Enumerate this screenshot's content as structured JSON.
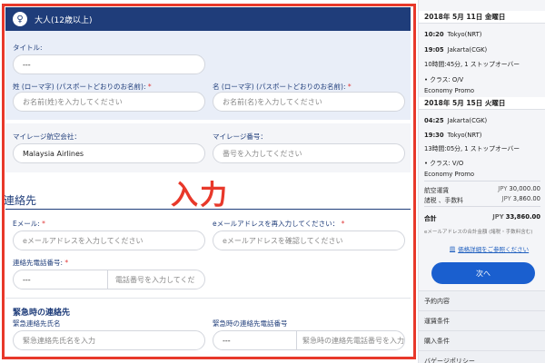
{
  "passenger": {
    "icon": "person-icon",
    "title": "大人(12歳以上)"
  },
  "form": {
    "title_label": "タイトル:",
    "title_value": "---",
    "last_name_label": "姓 (ローマ字) (パスポートどおりのお名前):",
    "last_name_placeholder": "お名前(姓)を入力してください",
    "first_name_label": "名 (ローマ字) (パスポートどおりのお名前):",
    "first_name_placeholder": "お名前(名)を入力してください",
    "required_mark": "*",
    "mileage_airline_label": "マイレージ航空会社：",
    "mileage_airline_value": "Malaysia Airlines",
    "mileage_number_label": "マイレージ番号：",
    "mileage_number_placeholder": "番号を入力してください"
  },
  "contact": {
    "heading": "連絡先",
    "email_label": "Eメール:",
    "email_placeholder": "eメールアドレスを入力してください",
    "email_confirm_label": "eメールアドレスを再入力してください：",
    "email_confirm_placeholder": "eメールアドレスを確認してください",
    "phone_label": "連絡先電話番号:",
    "phone_code": "---",
    "phone_placeholder": "電話番号を入力してくだ"
  },
  "emergency": {
    "heading": "緊急時の連絡先",
    "name_label": "緊急連絡先氏名",
    "name_placeholder": "緊急連絡先氏名を入力",
    "phone_label": "緊急時の連絡先電話番号",
    "phone_code": "---",
    "phone_placeholder": "緊急時の連絡先電話番号を入力"
  },
  "overlay": {
    "label": "入力",
    "color": "#e8382a"
  },
  "sidebar": {
    "outbound": {
      "date": "2018年 5月 11日 金曜日",
      "dep_time": "10:20",
      "dep_place": "Tokyo(NRT)",
      "arr_time": "19:05",
      "arr_place": "Jakarta(CGK)",
      "duration": "10時間:45分, 1 ストップオーバー",
      "class": "• クラス: O/V",
      "fare": "Economy Promo"
    },
    "inbound": {
      "date": "2018年 5月 15日 火曜日",
      "dep_time": "04:25",
      "dep_place": "Jakarta(CGK)",
      "arr_time": "19:30",
      "arr_place": "Tokyo(NRT)",
      "duration": "13時間:05分, 1 ストップオーバー",
      "class": "• クラス: V/O",
      "fare": "Economy Promo"
    },
    "prices": {
      "fare_label": "航空運賃",
      "fare_currency": "JPY",
      "fare_value": "30,000.00",
      "tax_label": "諸税 、手数料",
      "tax_currency": "JPY",
      "tax_value": "3,860.00",
      "total_label": "合計",
      "total_currency": "JPY",
      "total_value": "33,860.00",
      "note": "eメールアドレスの合計金額 (諸税・手数料含む)"
    },
    "price_link": "価格詳細をご参照ください",
    "next_button": "次へ",
    "links": [
      "予約内容",
      "運賃条件",
      "購入条件",
      "バゲージポリシー"
    ]
  }
}
